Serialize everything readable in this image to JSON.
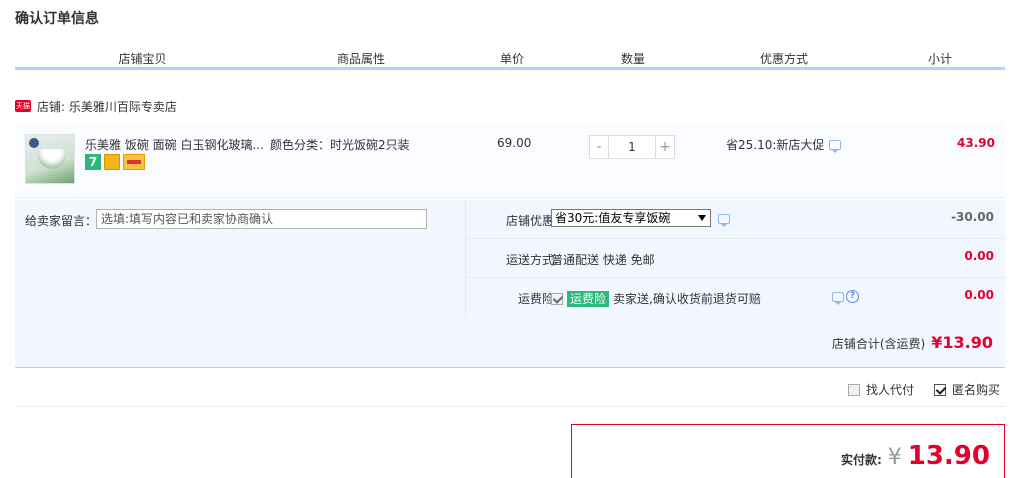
{
  "page": {
    "title": "确认订单信息"
  },
  "columns": [
    "店铺宝贝",
    "商品属性",
    "单价",
    "数量",
    "优惠方式",
    "小计"
  ],
  "shop": {
    "label": "店铺: 乐美雅川百际专卖店",
    "badge": "天猫"
  },
  "item": {
    "title": "乐美雅 饭碗 面碗 白玉钢化玻璃...",
    "sku": "颜色分类：时光饭碗2只装",
    "price": "69.00",
    "quantity": "1",
    "qty_minus": "-",
    "qty_plus": "+",
    "discount": "省25.10:新店大促",
    "subtotal": "43.90",
    "icon_7": "7"
  },
  "memo": {
    "label": "给卖家留言：",
    "placeholder": "选填:填写内容已和卖家协商确认"
  },
  "shop_discount": {
    "label": "店铺优惠:",
    "selected": "省30元:值友专享饭碗",
    "amount": "-30.00"
  },
  "shipping": {
    "label": "运送方式:",
    "value": "普通配送 快递 免邮",
    "amount": "0.00"
  },
  "insurance": {
    "label": "运费险:",
    "tag": "运费险",
    "value": "卖家送,确认收货前退货可赔",
    "amount": "0.00",
    "help": "?"
  },
  "shop_total": {
    "label": "店铺合计(含运费)",
    "value": "¥13.90"
  },
  "extras": {
    "proxy_pay": "找人代付",
    "anonymous": "匿名购买"
  },
  "payment": {
    "label": "实付款:",
    "currency": "¥",
    "value": "13.90"
  },
  "colors": {
    "accent": "#e4002b",
    "header_border": "#b2d1ff",
    "insure_green": "#2db77a"
  }
}
